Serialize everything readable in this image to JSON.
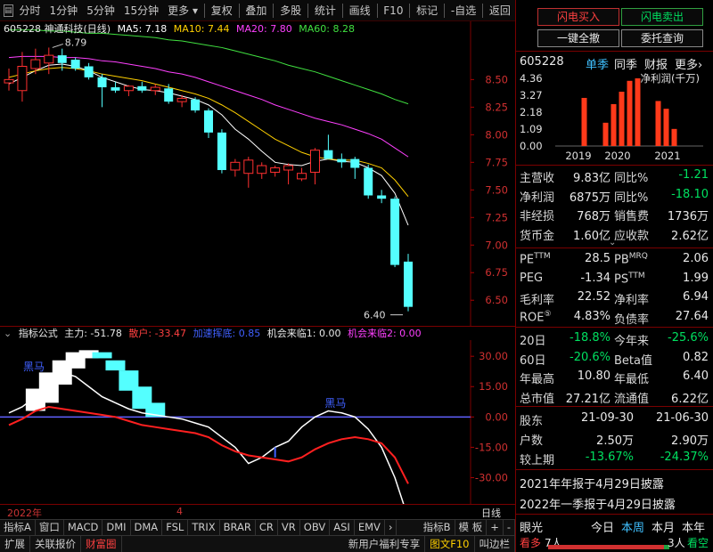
{
  "toolbar": {
    "items": [
      "分时",
      "1分钟",
      "5分钟",
      "15分钟",
      "更多"
    ],
    "items2": [
      "复权",
      "叠加",
      "多股",
      "统计",
      "画线",
      "F10",
      "标记",
      "-自选",
      "返回"
    ]
  },
  "stock": {
    "code_name": "605228 神通科技(日线)",
    "ma": [
      {
        "label": "MA5: 7.18",
        "color": "#ffffff"
      },
      {
        "label": "MA10: 7.44",
        "color": "#ffd000"
      },
      {
        "label": "MA20: 7.80",
        "color": "#ff40ff"
      },
      {
        "label": "MA60: 8.28",
        "color": "#40e040"
      }
    ]
  },
  "chart_data": [
    {
      "type": "candlestick",
      "y_ticks": [
        8.5,
        8.25,
        8.0,
        7.75,
        7.5,
        7.25,
        7.0,
        6.75,
        6.5
      ],
      "ylim": [
        6.3,
        8.85
      ],
      "annotations": [
        {
          "text": "8.79"
        },
        {
          "text": "6.40"
        }
      ],
      "candles": [
        {
          "o": 8.47,
          "h": 8.6,
          "l": 8.4,
          "c": 8.5
        },
        {
          "o": 8.4,
          "h": 8.75,
          "l": 8.3,
          "c": 8.62
        },
        {
          "o": 8.6,
          "h": 8.78,
          "l": 8.55,
          "c": 8.68
        },
        {
          "o": 8.65,
          "h": 8.79,
          "l": 8.55,
          "c": 8.72
        },
        {
          "o": 8.72,
          "h": 8.78,
          "l": 8.58,
          "c": 8.65
        },
        {
          "o": 8.68,
          "h": 8.7,
          "l": 8.58,
          "c": 8.6
        },
        {
          "o": 8.62,
          "h": 8.65,
          "l": 8.5,
          "c": 8.52
        },
        {
          "o": 8.52,
          "h": 8.55,
          "l": 8.25,
          "c": 8.43
        },
        {
          "o": 8.43,
          "h": 8.48,
          "l": 8.38,
          "c": 8.4
        },
        {
          "o": 8.4,
          "h": 8.45,
          "l": 8.35,
          "c": 8.44
        },
        {
          "o": 8.44,
          "h": 8.48,
          "l": 8.38,
          "c": 8.4
        },
        {
          "o": 8.4,
          "h": 8.46,
          "l": 8.36,
          "c": 8.43
        },
        {
          "o": 8.42,
          "h": 8.46,
          "l": 8.28,
          "c": 8.3
        },
        {
          "o": 8.3,
          "h": 8.36,
          "l": 8.25,
          "c": 8.33
        },
        {
          "o": 8.32,
          "h": 8.34,
          "l": 8.2,
          "c": 8.22
        },
        {
          "o": 8.22,
          "h": 8.24,
          "l": 7.97,
          "c": 8.02
        },
        {
          "o": 8.02,
          "h": 8.05,
          "l": 7.65,
          "c": 7.68
        },
        {
          "o": 7.68,
          "h": 7.78,
          "l": 7.62,
          "c": 7.75
        },
        {
          "o": 7.65,
          "h": 7.8,
          "l": 7.52,
          "c": 7.77
        },
        {
          "o": 7.65,
          "h": 7.75,
          "l": 7.6,
          "c": 7.72
        },
        {
          "o": 7.66,
          "h": 7.72,
          "l": 7.62,
          "c": 7.7
        },
        {
          "o": 7.68,
          "h": 7.74,
          "l": 7.55,
          "c": 7.72
        },
        {
          "o": 7.6,
          "h": 7.7,
          "l": 7.58,
          "c": 7.65
        },
        {
          "o": 7.66,
          "h": 7.88,
          "l": 7.55,
          "c": 7.86
        },
        {
          "o": 7.86,
          "h": 8.0,
          "l": 7.78,
          "c": 7.78
        },
        {
          "o": 7.78,
          "h": 7.83,
          "l": 7.7,
          "c": 7.75
        },
        {
          "o": 7.78,
          "h": 7.8,
          "l": 7.6,
          "c": 7.7
        },
        {
          "o": 7.7,
          "h": 7.73,
          "l": 7.42,
          "c": 7.45
        },
        {
          "o": 7.45,
          "h": 7.5,
          "l": 7.38,
          "c": 7.42
        },
        {
          "o": 7.42,
          "h": 7.44,
          "l": 6.8,
          "c": 6.82
        },
        {
          "o": 6.85,
          "h": 6.92,
          "l": 6.4,
          "c": 6.44
        }
      ],
      "ma_lines": {
        "ma5": [
          8.46,
          8.52,
          8.58,
          8.63,
          8.64,
          8.62,
          8.58,
          8.52,
          8.48,
          8.44,
          8.41,
          8.4,
          8.38,
          8.35,
          8.32,
          8.27,
          8.18,
          8.05,
          7.96,
          7.85,
          7.75,
          7.73,
          7.72,
          7.76,
          7.78,
          7.76,
          7.75,
          7.7,
          7.63,
          7.47,
          7.18
        ],
        "ma10": [
          8.52,
          8.55,
          8.58,
          8.6,
          8.61,
          8.6,
          8.58,
          8.55,
          8.53,
          8.51,
          8.49,
          8.46,
          8.43,
          8.4,
          8.37,
          8.33,
          8.27,
          8.2,
          8.12,
          8.04,
          7.96,
          7.9,
          7.84,
          7.8,
          7.78,
          7.77,
          7.77,
          7.74,
          7.7,
          7.59,
          7.44
        ],
        "ma20": [
          8.7,
          8.71,
          8.71,
          8.71,
          8.7,
          8.7,
          8.69,
          8.67,
          8.66,
          8.64,
          8.62,
          8.6,
          8.57,
          8.55,
          8.52,
          8.48,
          8.44,
          8.4,
          8.36,
          8.32,
          8.27,
          8.23,
          8.19,
          8.15,
          8.12,
          8.09,
          8.05,
          8.01,
          7.96,
          7.88,
          7.8
        ],
        "ma60": [
          8.95,
          8.95,
          8.95,
          8.94,
          8.94,
          8.93,
          8.92,
          8.92,
          8.91,
          8.9,
          8.89,
          8.88,
          8.86,
          8.85,
          8.83,
          8.81,
          8.79,
          8.76,
          8.73,
          8.7,
          8.67,
          8.63,
          8.6,
          8.57,
          8.53,
          8.49,
          8.45,
          8.41,
          8.37,
          8.32,
          8.28
        ]
      }
    },
    {
      "type": "indicator",
      "y_ticks": [
        30.0,
        15.0,
        0.0,
        -15.0,
        -30.0
      ],
      "ylim": [
        -43,
        38
      ],
      "main": [
        2,
        5,
        10,
        18,
        22,
        20,
        15,
        10,
        7,
        4,
        2,
        1,
        0,
        -1,
        -3,
        -5,
        -10,
        -15,
        -23,
        -20,
        -15,
        -12,
        -5,
        0,
        3,
        2,
        0,
        -6,
        -15,
        -30,
        -50
      ],
      "retail": [
        -4,
        -1,
        3,
        5,
        4,
        3,
        2,
        1,
        0,
        -2,
        -4,
        -5,
        -6,
        -7,
        -8,
        -10,
        -14,
        -17,
        -19,
        -20,
        -21,
        -22,
        -20,
        -16,
        -13,
        -11,
        -10,
        -11,
        -13,
        -20,
        -33
      ],
      "retail_hatch_range": [
        0,
        0,
        12
      ],
      "cyan_blocks": [
        {
          "i": 7,
          "top": 32,
          "bot": 29
        },
        {
          "i": 8,
          "top": 28,
          "bot": 23
        },
        {
          "i": 9,
          "top": 23,
          "bot": 13
        },
        {
          "i": 10,
          "top": 15,
          "bot": 4
        },
        {
          "i": 11,
          "top": 7,
          "bot": 0
        }
      ],
      "white_blocks": [
        {
          "i": 2,
          "top": 14,
          "bot": 3
        },
        {
          "i": 3,
          "top": 22,
          "bot": 7
        },
        {
          "i": 4,
          "top": 28,
          "bot": 16
        },
        {
          "i": 5,
          "top": 32,
          "bot": 24
        },
        {
          "i": 6,
          "top": 33,
          "bot": 29
        }
      ],
      "labels": [
        {
          "text": "黑马"
        },
        {
          "text": "黑马"
        }
      ]
    }
  ],
  "indicator": {
    "title": "指标公式",
    "main": "主力: -51.78",
    "retail": "散户: -33.47",
    "accelerate": "加速挥底: 0.85",
    "chance1": "机会来临1: 0.00",
    "chance2": "机会来临2: 0.00"
  },
  "time_axis": {
    "year": "2022年",
    "month": "4",
    "period": "日线"
  },
  "tabs1": [
    "指标A",
    "窗口",
    "MACD",
    "DMI",
    "DMA",
    "FSL",
    "TRIX",
    "BRAR",
    "CR",
    "VR",
    "OBV",
    "ASI",
    "EMV"
  ],
  "tabs1_right": [
    "指标B",
    "模 板",
    "+",
    "-"
  ],
  "tabs2": [
    "扩展",
    "关联报价",
    "财富圈"
  ],
  "tabs2_right": [
    "新用户福利专享",
    "图文F10",
    "叫边栏"
  ],
  "right": {
    "buy": "闪电买入",
    "sell": "闪电卖出",
    "cancel": "一键全撤",
    "query": "委托查询",
    "code": "605228",
    "subtabs": [
      "单季",
      "同季",
      "财报",
      "更多"
    ],
    "bar_title": "净利润(千万)",
    "bar_years": [
      "2019",
      "2020",
      "2021"
    ],
    "bar_ticks": [
      "4.36",
      "3.27",
      "2.18",
      "1.09",
      "0.00"
    ],
    "bar_values": [
      3.1,
      1.5,
      2.7,
      3.5,
      4.2,
      4.36,
      2.9,
      2.4,
      1.1
    ],
    "fin": [
      {
        "l": "主营收",
        "v": "9.83亿",
        "l2": "同比%",
        "v2": "-1.21"
      },
      {
        "l": "净利润",
        "v": "6875万",
        "l2": "同比%",
        "v2": "-18.10"
      },
      {
        "l": "非经损",
        "v": "768万",
        "l2": "销售费",
        "v2": "1736万"
      },
      {
        "l": "货币金",
        "v": "1.60亿",
        "l2": "应收款",
        "v2": "2.62亿"
      }
    ],
    "val": [
      {
        "l": "PE",
        "sup": "TTM",
        "v": "28.5",
        "l2": "PB",
        "sup2": "MRQ",
        "v2": "2.06"
      },
      {
        "l": "PEG",
        "sup": "",
        "v": "-1.34",
        "l2": "PS",
        "sup2": "TTM",
        "v2": "1.99"
      },
      {
        "l": "毛利率",
        "sup": "",
        "v": "22.52",
        "l2": "净利率",
        "sup2": "",
        "v2": "6.94"
      },
      {
        "l": "ROE",
        "sup": "⑤",
        "v": "4.83%",
        "l2": "负债率",
        "sup2": "",
        "v2": "27.64"
      }
    ],
    "perf": [
      {
        "l": "20日",
        "v": "-18.8%",
        "l2": "今年来",
        "v2": "-25.6%"
      },
      {
        "l": "60日",
        "v": "-20.6%",
        "l2": "Beta值",
        "v2": "0.82"
      },
      {
        "l": "年最高",
        "v": "10.80",
        "l2": "年最低",
        "v2": "6.40"
      },
      {
        "l": "总市值",
        "v": "27.21亿",
        "l2": "流通值",
        "v2": "6.22亿"
      }
    ],
    "holders": [
      {
        "l": "股东",
        "v": "21-09-30",
        "v2": "21-06-30"
      },
      {
        "l": "户数",
        "v": "2.50万",
        "v2": "2.90万"
      },
      {
        "l": "较上期",
        "v": "-13.67%",
        "v2": "-24.37%"
      }
    ],
    "notice1": "2021年年报于4月29日披露",
    "notice2": "2022年一季报于4月29日披露",
    "eye": {
      "label": "眼光",
      "tabs": [
        "今日",
        "本周",
        "本月",
        "本年"
      ]
    },
    "footer": {
      "l": "看多",
      "lv": "7人",
      "r": "3人",
      "rl": "看空"
    }
  }
}
